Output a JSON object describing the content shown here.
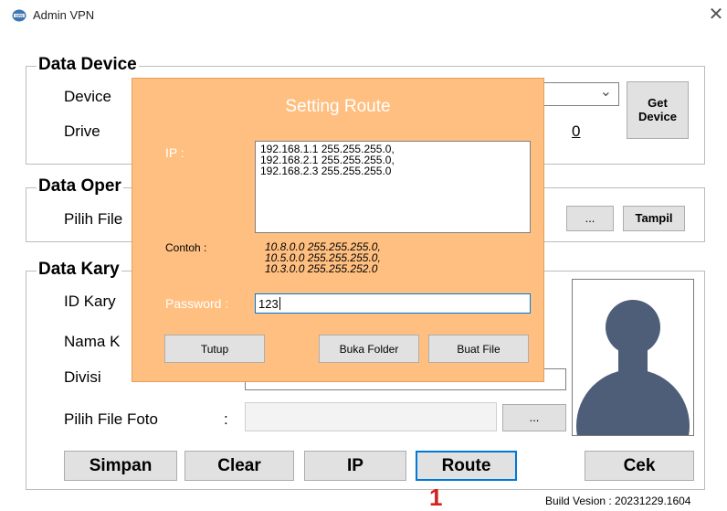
{
  "window": {
    "title": "Admin VPN",
    "close_glyph": "✕"
  },
  "device_group": {
    "title": "Data Device",
    "device_label": "Device",
    "drive_label": "Drive",
    "drive_value_tail": "0",
    "get_device_button": "Get Device",
    "dropdown_glyph": "⌄"
  },
  "operator_group": {
    "title": "Data Oper",
    "pilih_file_label": "Pilih File",
    "browse_button": "...",
    "tampil_button": "Tampil"
  },
  "karyawan_group": {
    "title": "Data Kary",
    "id_label": "ID Kary",
    "nama_label": "Nama K",
    "divisi_label": "Divisi",
    "foto_label": "Pilih File Foto",
    "foto_colon": ":",
    "foto_browse_button": "..."
  },
  "actions": {
    "simpan": "Simpan",
    "clear": "Clear",
    "ip": "IP",
    "route": "Route",
    "cek": "Cek"
  },
  "build_version": "Build Vesion : 20231229.1604",
  "annotation_marker": "1",
  "dialog": {
    "title": "Setting Route",
    "ip_label": "IP :",
    "ip_lines": [
      "192.168.1.1 255.255.255.0,",
      "192.168.2.1 255.255.255.0,",
      "192.168.2.3 255.255.255.0"
    ],
    "contoh_label": "Contoh :",
    "example_lines": [
      "10.8.0.0 255.255.255.0,",
      "10.5.0.0 255.255.255.0,",
      "10.3.0.0 255.255.252.0"
    ],
    "password_label": "Password :",
    "password_value": "123",
    "tutup_button": "Tutup",
    "buka_folder_button": "Buka Folder",
    "buat_file_button": "Buat File"
  },
  "colors": {
    "dialog_bg": "#ffbf80",
    "focus_border": "#0078d7",
    "marker": "#d72020"
  }
}
